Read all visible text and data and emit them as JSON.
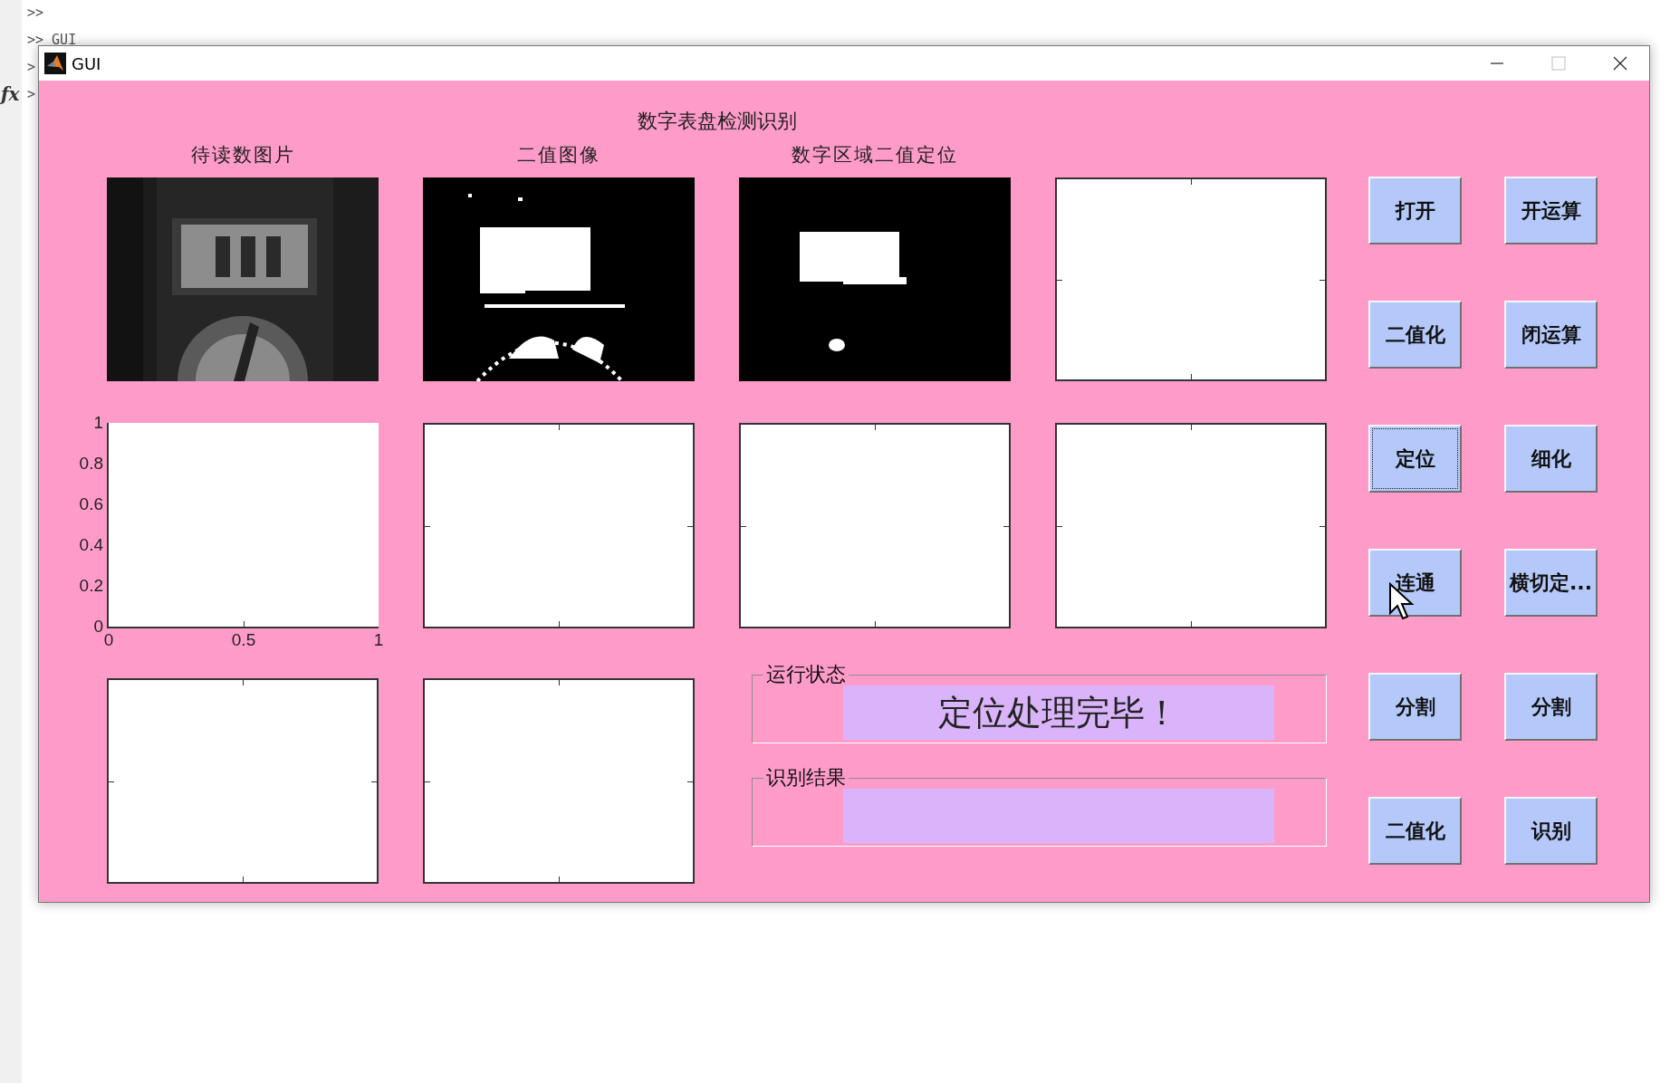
{
  "console": {
    "prompts": [
      ">>",
      ">> GUI",
      ">",
      ">"
    ],
    "fx": "fx"
  },
  "window": {
    "title": "GUI"
  },
  "heading": "数字表盘检测识别",
  "axes_rows": [
    [
      {
        "kind": "picture",
        "label": "待读数图片"
      },
      {
        "kind": "picture",
        "label": "二值图像"
      },
      {
        "kind": "picture",
        "label": "数字区域二值定位"
      },
      {
        "kind": "empty"
      }
    ],
    [
      {
        "kind": "ticked",
        "xticks": [
          "0",
          "0.5",
          "1"
        ],
        "yticks": [
          "1",
          "0.8",
          "0.6",
          "0.4",
          "0.2",
          "0"
        ]
      },
      {
        "kind": "empty"
      },
      {
        "kind": "empty"
      },
      {
        "kind": "empty"
      }
    ],
    [
      {
        "kind": "empty"
      },
      {
        "kind": "empty"
      }
    ]
  ],
  "panels": [
    {
      "title": "运行状态",
      "value": "定位处理完毕！"
    },
    {
      "title": "识别结果"
    }
  ],
  "buttons": [
    {
      "label": "打开",
      "focused": false
    },
    {
      "label": "开运算",
      "focused": false
    },
    {
      "label": "二值化",
      "focused": false
    },
    {
      "label": "闭运算",
      "focused": false
    },
    {
      "label": "定位",
      "focused": true
    },
    {
      "label": "细化",
      "focused": false
    },
    {
      "label": "连通",
      "focused": false
    },
    {
      "label": "横切定...",
      "focused": false
    },
    {
      "label": "分割",
      "focused": false
    },
    {
      "label": "分割",
      "focused": false
    },
    {
      "label": "二值化",
      "focused": false
    },
    {
      "label": "识别",
      "focused": false
    }
  ]
}
